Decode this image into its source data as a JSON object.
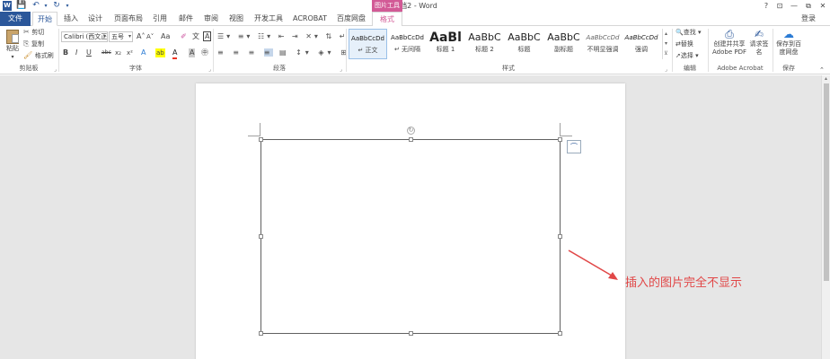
{
  "window": {
    "doc_title": "文档2 - Word",
    "picture_tools": "图片工具",
    "minimize": "—",
    "restore": "⧉",
    "close": "✕",
    "help": "?",
    "ribbon_display": "⊡"
  },
  "qat": {
    "word_icon": "W",
    "save": "💾",
    "undo": "↶",
    "redo": "↻",
    "customize": "▾"
  },
  "tabs": [
    "文件",
    "开始",
    "插入",
    "设计",
    "页面布局",
    "引用",
    "邮件",
    "审阅",
    "视图",
    "开发工具",
    "ACROBAT",
    "百度网盘",
    "格式"
  ],
  "signin": "登录",
  "clipboard": {
    "paste": "粘贴",
    "cut": "剪切",
    "copy": "复制",
    "format_painter": "格式刷",
    "label": "剪贴板"
  },
  "font": {
    "name": "Calibri (西文正",
    "size": "五号",
    "grow": "A˄",
    "shrink": "A˅",
    "case": "Aa",
    "clear": "✐",
    "phonetic": "文",
    "border": "A",
    "bold": "B",
    "italic": "I",
    "underline": "U",
    "strike": "abc",
    "sub": "x₂",
    "sup": "x²",
    "effects": "A",
    "highlight": "ab",
    "color": "A",
    "shade": "A",
    "circled": "㊥",
    "label": "字体"
  },
  "paragraph": {
    "label": "段落"
  },
  "styles": {
    "items": [
      {
        "sample": "AaBbCcDd",
        "name": "↵ 正文"
      },
      {
        "sample": "AaBbCcDd",
        "name": "↵ 无间隔"
      },
      {
        "sample": "AaBl",
        "name": "标题 1"
      },
      {
        "sample": "AaBbC",
        "name": "标题 2"
      },
      {
        "sample": "AaBbC",
        "name": "标题"
      },
      {
        "sample": "AaBbC",
        "name": "副标题"
      },
      {
        "sample": "AaBbCcDd",
        "name": "不明显强调"
      },
      {
        "sample": "AaBbCcDd",
        "name": "强调"
      }
    ],
    "label": "样式"
  },
  "editing": {
    "find": "查找",
    "replace": "替换",
    "select": "选择",
    "label": "编辑"
  },
  "acrobat": {
    "create_pdf": "创建并共享 Adobe PDF",
    "request_sign": "请求签名",
    "label": "Adobe Acrobat"
  },
  "save_group": {
    "save_baidu": "保存到百度网盘",
    "label": "保存"
  },
  "annotation": "插入的图片完全不显示",
  "colors": {
    "accent": "#2b579a",
    "picture_tools": "#d25a96",
    "annotation": "#e14747"
  }
}
